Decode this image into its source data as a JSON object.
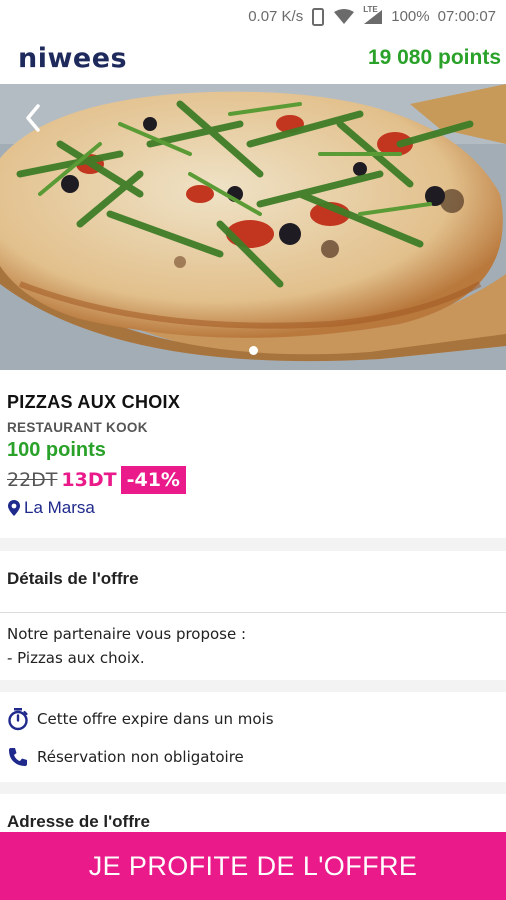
{
  "status_bar": {
    "speed": "0.07 K/s",
    "network": "LTE",
    "battery": "100%",
    "time": "07:00:07"
  },
  "header": {
    "logo": "niwees",
    "points_balance": "19 080 points"
  },
  "hero": {
    "image": "pizza-photo",
    "carousel_position": 1,
    "carousel_count": 1
  },
  "offer": {
    "title": "PIZZAS AUX CHOIX",
    "restaurant": "RESTAURANT KOOK",
    "points": "100 points",
    "old_price": "22DT",
    "new_price": "13DT",
    "discount": "-41%",
    "location": "La Marsa"
  },
  "details": {
    "title": "Détails de l'offre",
    "line1": "Notre partenaire vous propose :",
    "line2": "- Pizzas aux choix."
  },
  "features": [
    {
      "icon": "timer-icon",
      "text": "Cette offre expire dans un mois"
    },
    {
      "icon": "phone-icon",
      "text": "Réservation non obligatoire"
    }
  ],
  "address": {
    "title": "Adresse de l'offre"
  },
  "cta": {
    "label": "JE PROFITE DE L'OFFRE"
  },
  "colors": {
    "brand_navy": "#1f2a5c",
    "points_green": "#2aa22a",
    "accent_pink": "#ea1a8a"
  }
}
